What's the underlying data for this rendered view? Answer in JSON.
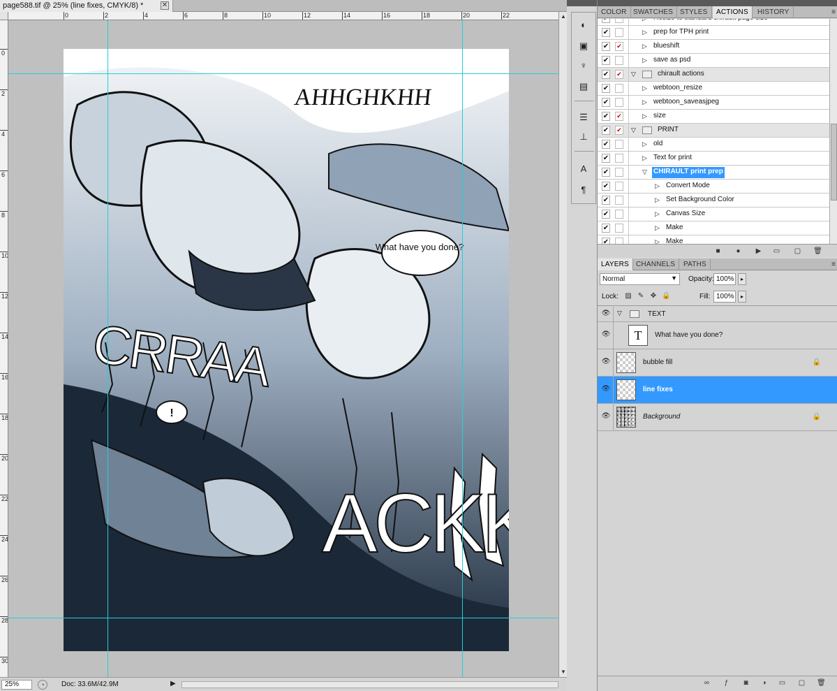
{
  "document": {
    "tab_title": "page588.tif @ 25% (line fixes, CMYK/8) *",
    "close_glyph": "✕",
    "zoom": "25%",
    "doc_info": "Doc: 33.6M/42.9M"
  },
  "ruler_top": [
    "0",
    "2",
    "4",
    "6",
    "8",
    "10",
    "12",
    "14",
    "16",
    "18",
    "20",
    "22"
  ],
  "ruler_left": [
    "0",
    "2",
    "4",
    "6",
    "8",
    "10",
    "12",
    "14",
    "16",
    "18",
    "20",
    "22",
    "24",
    "26",
    "28",
    "30"
  ],
  "artwork": {
    "sfx_top": "AHHGHKHH",
    "speech": "What have you done?",
    "sfx_big_1": "CRRAA",
    "sfx_big_2": "ACKK",
    "exclaim": "!"
  },
  "actions_tabs": [
    "COLOR",
    "SWATCHES",
    "STYLES",
    "ACTIONS",
    "HISTORY"
  ],
  "actions_active": "ACTIONS",
  "actions": [
    {
      "label": "Resize to standard chirault page size",
      "level": 1,
      "check_red": false,
      "dialog": false
    },
    {
      "label": "prep for TPH print",
      "level": 1,
      "check_red": false,
      "dialog": false
    },
    {
      "label": "blueshift",
      "level": 1,
      "check_red": true,
      "dialog": false
    },
    {
      "label": "save as psd",
      "level": 1,
      "check_red": false,
      "dialog": false
    },
    {
      "label": "chirault actions",
      "level": 0,
      "check_red": true,
      "dialog": false
    },
    {
      "label": "webtoon_resize",
      "level": 1,
      "check_red": false,
      "dialog": false
    },
    {
      "label": "webtoon_saveasjpeg",
      "level": 1,
      "check_red": false,
      "dialog": false
    },
    {
      "label": "size",
      "level": 1,
      "check_red": true,
      "dialog": false
    },
    {
      "label": "PRINT",
      "level": 0,
      "check_red": true,
      "dialog": false
    },
    {
      "label": "old",
      "level": 1,
      "check_red": false,
      "dialog": false
    },
    {
      "label": "Text for print",
      "level": 1,
      "check_red": false,
      "dialog": false
    },
    {
      "label": "CHIRAULT print prep",
      "level": 1,
      "check_red": false,
      "dialog": false,
      "selected": true,
      "expanded": true
    },
    {
      "label": "Convert Mode",
      "level": 2,
      "check_red": false,
      "dialog": false
    },
    {
      "label": "Set Background Color",
      "level": 2,
      "check_red": false,
      "dialog": false
    },
    {
      "label": "Canvas Size",
      "level": 2,
      "check_red": false,
      "dialog": false
    },
    {
      "label": "Make",
      "level": 2,
      "check_red": false,
      "dialog": false
    },
    {
      "label": "Make",
      "level": 2,
      "check_red": false,
      "dialog": false
    }
  ],
  "actions_footer_icons": [
    "stop-icon",
    "record-icon",
    "play-icon",
    "new-set-icon",
    "new-action-icon",
    "trash-icon"
  ],
  "layers_tabs": [
    "LAYERS",
    "CHANNELS",
    "PATHS"
  ],
  "layers_active": "LAYERS",
  "layers_options": {
    "blend_mode": "Normal",
    "opacity_label": "Opacity:",
    "opacity": "100%",
    "lock_label": "Lock:",
    "fill_label": "Fill:",
    "fill": "100%"
  },
  "layers": [
    {
      "name": "TEXT",
      "kind": "group"
    },
    {
      "name": "What have you done?",
      "kind": "text"
    },
    {
      "name": "bubble fill",
      "kind": "pixel",
      "locked": true
    },
    {
      "name": "line fixes",
      "kind": "pixel",
      "selected": true
    },
    {
      "name": "Background",
      "kind": "background",
      "locked": true
    }
  ],
  "colors": {
    "selection": "#3399ff",
    "guide": "#22d0d8",
    "panel": "#d6d6d6"
  }
}
